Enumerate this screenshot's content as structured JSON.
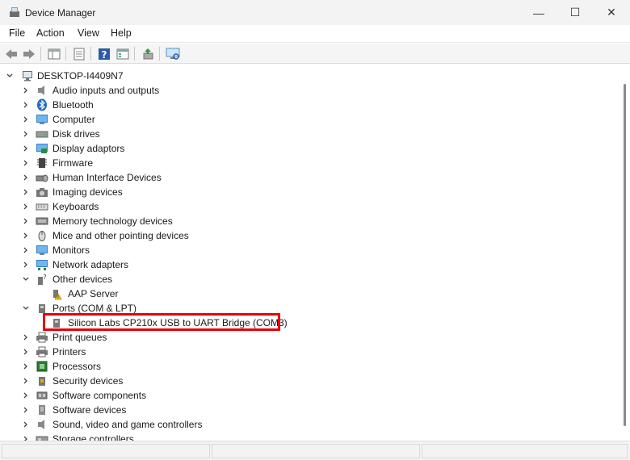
{
  "window": {
    "title": "Device Manager",
    "minimize_glyph": "—",
    "maximize_glyph": "☐",
    "close_glyph": "✕"
  },
  "menu": [
    "File",
    "Action",
    "View",
    "Help"
  ],
  "toolbar_icons": [
    "back-icon",
    "forward-icon",
    "show-hide-console-tree-icon",
    "properties-icon",
    "help-icon",
    "view-icon",
    "update-driver-icon",
    "scan-hardware-icon"
  ],
  "tree": {
    "root": "DESKTOP-I4409N7",
    "categories": [
      {
        "label": "Audio inputs and outputs",
        "icon": "speaker-icon",
        "expanded": false
      },
      {
        "label": "Bluetooth",
        "icon": "bluetooth-icon",
        "expanded": false
      },
      {
        "label": "Computer",
        "icon": "monitor-icon",
        "expanded": false
      },
      {
        "label": "Disk drives",
        "icon": "disk-drive-icon",
        "expanded": false
      },
      {
        "label": "Display adaptors",
        "icon": "display-adapter-icon",
        "expanded": false
      },
      {
        "label": "Firmware",
        "icon": "firmware-icon",
        "expanded": false
      },
      {
        "label": "Human Interface Devices",
        "icon": "hid-icon",
        "expanded": false
      },
      {
        "label": "Imaging devices",
        "icon": "camera-icon",
        "expanded": false
      },
      {
        "label": "Keyboards",
        "icon": "keyboard-icon",
        "expanded": false
      },
      {
        "label": "Memory technology devices",
        "icon": "memory-icon",
        "expanded": false
      },
      {
        "label": "Mice and other pointing devices",
        "icon": "mouse-icon",
        "expanded": false
      },
      {
        "label": "Monitors",
        "icon": "monitor-icon",
        "expanded": false
      },
      {
        "label": "Network adapters",
        "icon": "network-icon",
        "expanded": false
      },
      {
        "label": "Other devices",
        "icon": "unknown-device-icon",
        "expanded": true,
        "children": [
          "AAP Server"
        ]
      },
      {
        "label": "Ports (COM & LPT)",
        "icon": "port-icon",
        "expanded": true,
        "children": [
          "Silicon Labs CP210x USB to UART Bridge (COM3)"
        ]
      },
      {
        "label": "Print queues",
        "icon": "printer-icon",
        "expanded": false
      },
      {
        "label": "Printers",
        "icon": "printer-icon",
        "expanded": false
      },
      {
        "label": "Processors",
        "icon": "processor-icon",
        "expanded": false
      },
      {
        "label": "Security devices",
        "icon": "security-icon",
        "expanded": false
      },
      {
        "label": "Software components",
        "icon": "software-component-icon",
        "expanded": false
      },
      {
        "label": "Software devices",
        "icon": "software-device-icon",
        "expanded": false
      },
      {
        "label": "Sound, video and game controllers",
        "icon": "speaker-icon",
        "expanded": false
      },
      {
        "label": "Storage controllers",
        "icon": "storage-controller-icon",
        "expanded": false
      }
    ]
  },
  "highlight_color": "#e8000c"
}
